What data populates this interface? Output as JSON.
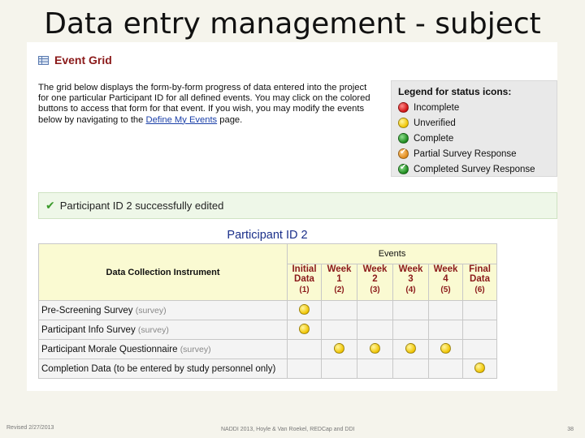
{
  "slide": {
    "title": "Data entry management - subject",
    "footer_left": "Revised 2/27/2013",
    "footer_center": "NADDI 2013, Hoyle & Van Roekel, REDCap and DDI",
    "page_number": "38"
  },
  "event_grid": {
    "header_title": "Event Grid",
    "intro_part1": "The grid below displays the form-by-form progress of data entered into the project for one particular Participant ID for all defined events. You may click on the colored buttons to access that form for that event. If you wish, you may modify the events below by navigating to the ",
    "intro_link": "Define My Events",
    "intro_part2": " page."
  },
  "legend": {
    "title": "Legend for status icons:",
    "items": [
      {
        "icon": "red-status-icon",
        "label": "Incomplete",
        "color": "#d01010"
      },
      {
        "icon": "yellow-status-icon",
        "label": "Unverified",
        "color": "#f0c400"
      },
      {
        "icon": "green-status-icon",
        "label": "Complete",
        "color": "#1d8a1d"
      },
      {
        "icon": "orange-check-status-icon",
        "label": "Partial Survey Response",
        "color": "#e08a1a"
      },
      {
        "icon": "green-check-status-icon",
        "label": "Completed Survey Response",
        "color": "#1d8a1d"
      }
    ]
  },
  "success_message": "Participant ID 2 successfully edited",
  "participant_title": "Participant ID 2",
  "grid": {
    "instrument_header": "Data Collection Instrument",
    "events_header": "Events",
    "events": [
      {
        "line1": "Initial",
        "line2": "Data",
        "num": "(1)"
      },
      {
        "line1": "Week",
        "line2": "1",
        "num": "(2)"
      },
      {
        "line1": "Week",
        "line2": "2",
        "num": "(3)"
      },
      {
        "line1": "Week",
        "line2": "3",
        "num": "(4)"
      },
      {
        "line1": "Week",
        "line2": "4",
        "num": "(5)"
      },
      {
        "line1": "Final",
        "line2": "Data",
        "num": "(6)"
      }
    ],
    "rows": [
      {
        "name": "Pre-Screening Survey",
        "tag": "(survey)",
        "cells": [
          "yellow",
          "",
          "",
          "",
          "",
          ""
        ]
      },
      {
        "name": "Participant Info Survey",
        "tag": "(survey)",
        "cells": [
          "yellow",
          "",
          "",
          "",
          "",
          ""
        ]
      },
      {
        "name": "Participant Morale Questionnaire",
        "tag": "(survey)",
        "cells": [
          "",
          "yellow",
          "yellow",
          "yellow",
          "yellow",
          ""
        ]
      },
      {
        "name": "Completion Data (to be entered by study personnel only)",
        "tag": "",
        "cells": [
          "",
          "",
          "",
          "",
          "",
          "yellow"
        ]
      }
    ]
  }
}
